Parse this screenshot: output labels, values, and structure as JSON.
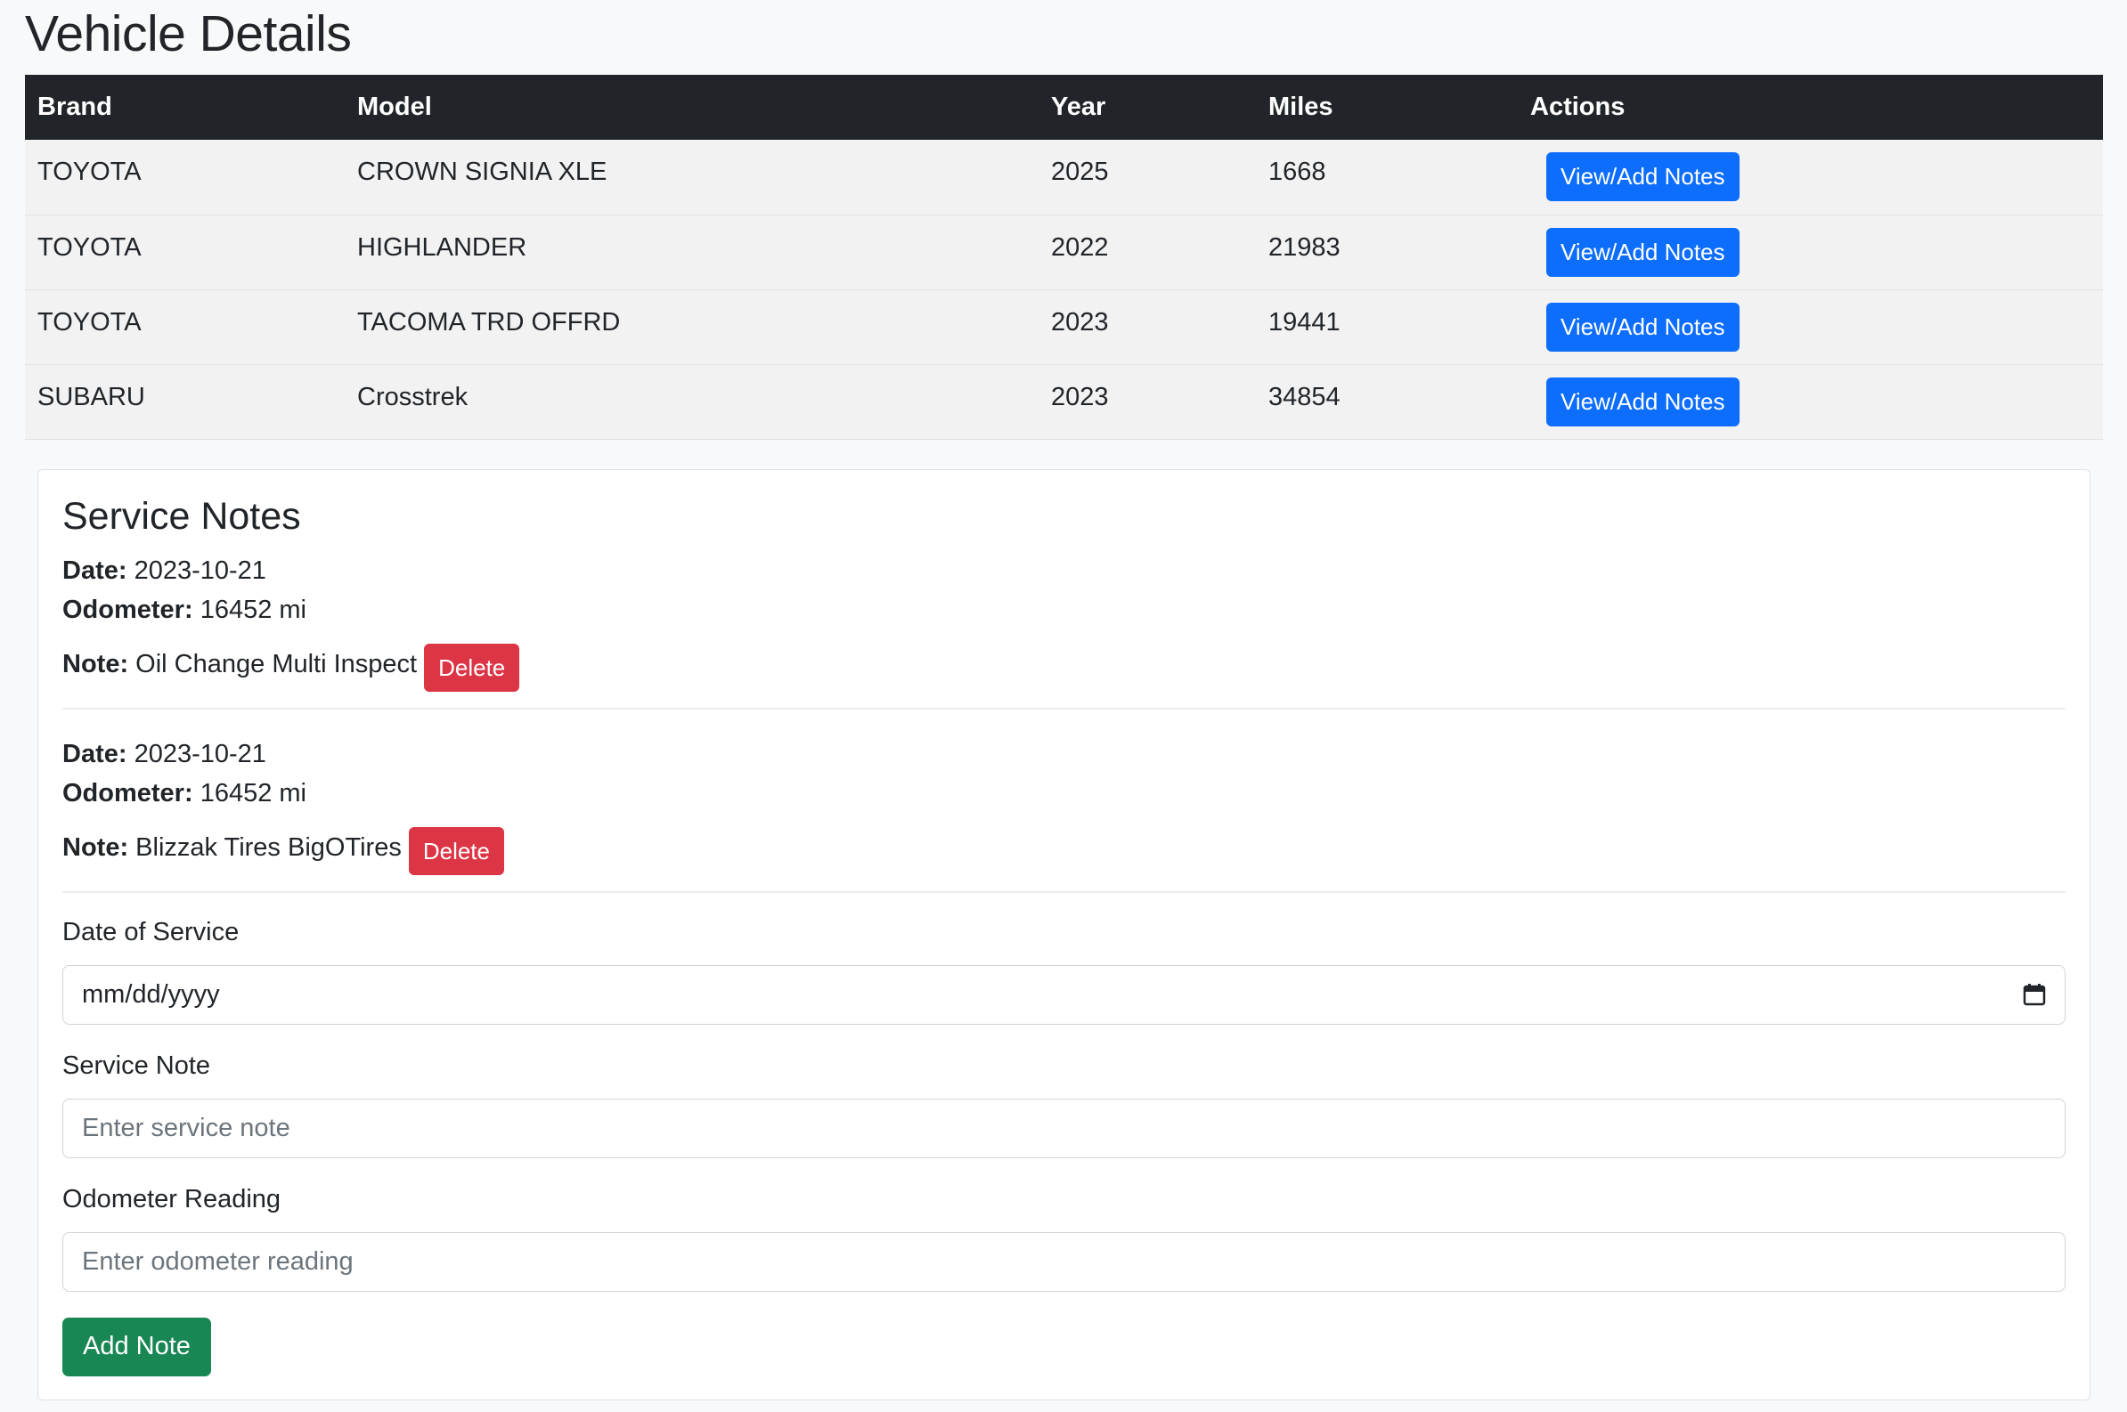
{
  "page": {
    "title": "Vehicle Details"
  },
  "table": {
    "headers": {
      "brand": "Brand",
      "model": "Model",
      "year": "Year",
      "miles": "Miles",
      "actions": "Actions"
    },
    "rows": [
      {
        "brand": "TOYOTA",
        "model": "CROWN SIGNIA XLE",
        "year": "2025",
        "miles": "1668",
        "action": "View/Add Notes"
      },
      {
        "brand": "TOYOTA",
        "model": "HIGHLANDER",
        "year": "2022",
        "miles": "21983",
        "action": "View/Add Notes"
      },
      {
        "brand": "TOYOTA",
        "model": "TACOMA TRD OFFRD",
        "year": "2023",
        "miles": "19441",
        "action": "View/Add Notes"
      },
      {
        "brand": "SUBARU",
        "model": "Crosstrek",
        "year": "2023",
        "miles": "34854",
        "action": "View/Add Notes"
      }
    ]
  },
  "service_notes": {
    "title": "Service Notes",
    "labels": {
      "date": "Date:",
      "odometer": "Odometer:",
      "note": "Note:"
    },
    "delete_label": "Delete",
    "notes": [
      {
        "date": "2023-10-21",
        "odometer": "16452 mi",
        "note": "Oil Change Multi Inspect"
      },
      {
        "date": "2023-10-21",
        "odometer": "16452 mi",
        "note": "Blizzak Tires BigOTires"
      }
    ]
  },
  "form": {
    "date_label": "Date of Service",
    "date_value": "mm/dd/yyyy",
    "note_label": "Service Note",
    "note_placeholder": "Enter service note",
    "odometer_label": "Odometer Reading",
    "odometer_placeholder": "Enter odometer reading",
    "submit_label": "Add Note"
  },
  "colors": {
    "primary": "#0d6efd",
    "danger": "#dc3545",
    "success": "#198754",
    "header_dark": "#212529"
  },
  "icons": {
    "date_picker": "calendar-icon"
  }
}
